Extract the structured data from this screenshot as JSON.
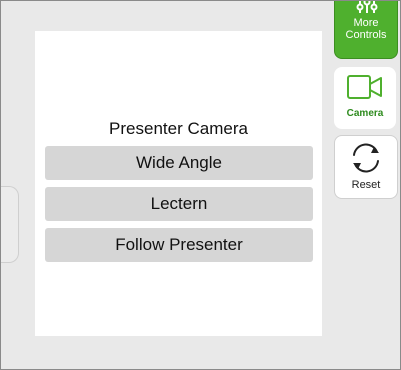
{
  "panel": {
    "title": "Presenter Camera",
    "presets": [
      "Wide Angle",
      "Lectern",
      "Follow Presenter"
    ]
  },
  "sidebar": {
    "more_controls": {
      "line1": "More",
      "line2": "Controls",
      "icon": "sliders-icon"
    },
    "camera": {
      "label": "Camera",
      "icon": "video-camera-icon"
    },
    "reset": {
      "label": "Reset",
      "icon": "refresh-icon"
    }
  },
  "colors": {
    "accent_green": "#4fb02e",
    "camera_green": "#2e8b1e",
    "preset_gray": "#d6d6d6",
    "background": "#e9e9e9"
  }
}
